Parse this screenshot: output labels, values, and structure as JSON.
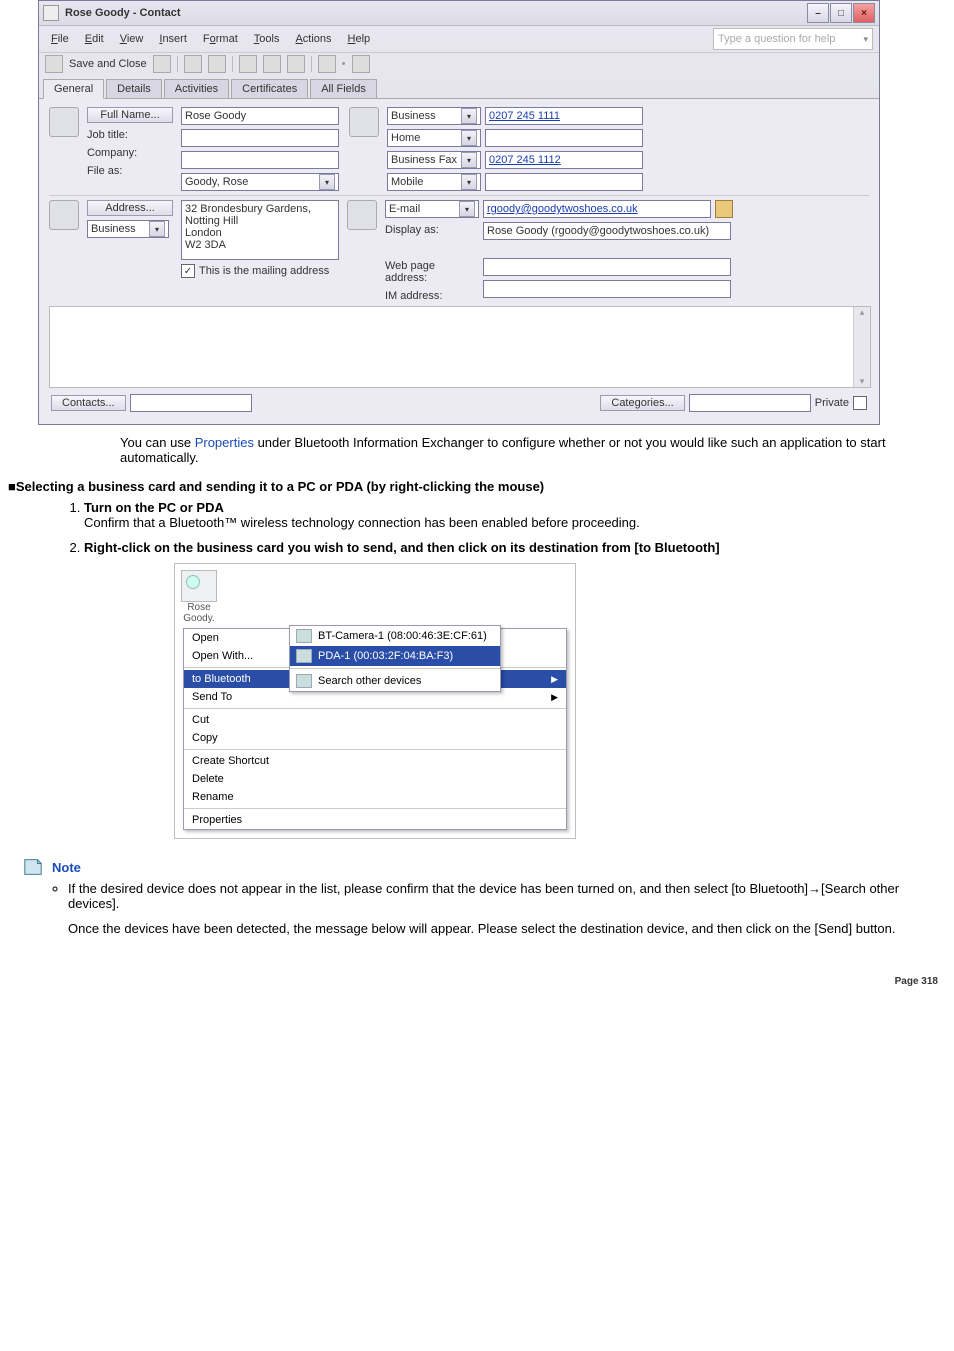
{
  "window": {
    "title": "Rose Goody - Contact",
    "help_placeholder": "Type a question for help",
    "menu": [
      "File",
      "Edit",
      "View",
      "Insert",
      "Format",
      "Tools",
      "Actions",
      "Help"
    ],
    "save_close": "Save and Close",
    "tabs": [
      "General",
      "Details",
      "Activities",
      "Certificates",
      "All Fields"
    ],
    "labels": {
      "fullname": "Full Name...",
      "jobtitle": "Job title:",
      "company": "Company:",
      "fileas": "File as:",
      "business": "Business",
      "home": "Home",
      "bizfax": "Business Fax",
      "mobile": "Mobile",
      "address": "Address...",
      "addr_type": "Business",
      "email": "E-mail",
      "display_as": "Display as:",
      "web": "Web page address:",
      "im": "IM address:",
      "mailing": "This is the mailing address",
      "contacts": "Contacts...",
      "categories": "Categories...",
      "private": "Private"
    },
    "values": {
      "fullname": "Rose Goody",
      "fileas": "Goody, Rose",
      "biz_phone": "0207 245 1111",
      "bizfax_phone": "0207 245 1112",
      "address": "32  Brondesbury Gardens,\nNotting Hill\nLondon\nW2 3DA",
      "email": "rgoody@goodytwoshoes.co.uk",
      "display_as": "Rose Goody (rgoody@goodytwoshoes.co.uk)"
    }
  },
  "doc": {
    "p1a": "You can use ",
    "p1link": "Properties",
    "p1b": " under Bluetooth Information Exchanger to configure whether or not you would like such an application to start automatically.",
    "h2": "■Selecting a business card and sending it to a PC or PDA (by right-clicking the mouse)",
    "step1_title": "Turn on the PC or PDA",
    "step1_text": "Confirm that a Bluetooth™ wireless technology connection has been enabled before proceeding.",
    "step2_title": "Right-click on the business card you wish to send, and then click on its destination from [to Bluetooth]"
  },
  "ctx": {
    "card_name": "Rose\nGoody.",
    "items": {
      "open": "Open",
      "openwith": "Open With...",
      "tobt": "to Bluetooth",
      "sendto": "Send To",
      "cut": "Cut",
      "copy": "Copy",
      "shortcut": "Create Shortcut",
      "delete": "Delete",
      "rename": "Rename",
      "props": "Properties"
    },
    "submenu": {
      "dev1": "BT-Camera-1 (08:00:46:3E:CF:61)",
      "dev2": "PDA-1 (00:03:2F:04:BA:F3)",
      "search": "Search other devices"
    }
  },
  "note": {
    "label": "Note",
    "li1": "If the desired device does not appear in the list, please confirm that the device has been turned on, and then select [to Bluetooth]→[Search other devices].",
    "li1b": "Once the devices have been detected, the message below will appear. Please select the destination device, and then click on the [Send] button."
  },
  "footer": {
    "page": "Page 318"
  }
}
